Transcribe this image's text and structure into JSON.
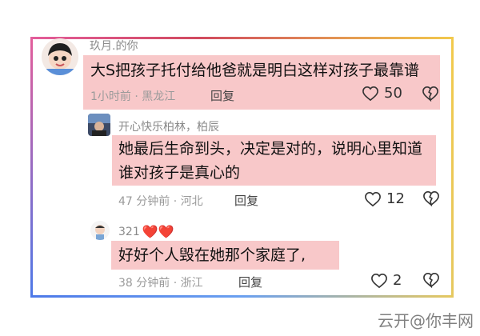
{
  "comments": [
    {
      "username": "玖月.的你",
      "text": "大S把孩子托付给他爸就是明白这样对孩子最靠谱",
      "meta": "1小时前 · 黑龙江",
      "reply": "回复",
      "likes": "50"
    },
    {
      "username": "开心快乐柏林，柏辰",
      "text_line1": "她最后生命到头，决定是对的，说明心里知道",
      "text_line2": "谁对孩子是真心的",
      "meta": "47 分钟前 · 河北",
      "reply": "回复",
      "likes": "12"
    },
    {
      "username": "321",
      "username_emoji": "❤️❤️",
      "text": "好好个人毁在她那个家庭了,",
      "meta": "38 分钟前 · 浙江",
      "reply": "回复",
      "likes": "2"
    }
  ],
  "watermark": "云开@你丰网"
}
